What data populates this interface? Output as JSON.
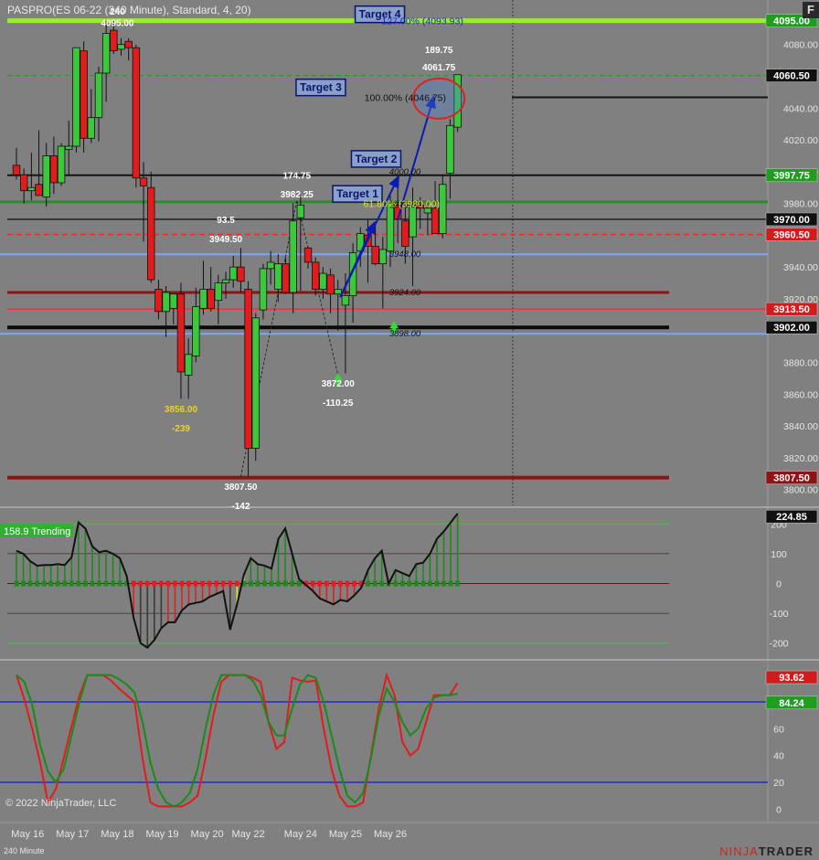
{
  "header": {
    "title": "PASPRO(ES 06-22 (240 Minute), Standard, 4, 20)",
    "f_button": "F",
    "copyright": "© 2022 NinjaTrader, LLC",
    "timeframe": "240 Minute",
    "brand_a": "NINJA",
    "brand_b": "TRADER"
  },
  "colors": {
    "bg": "#808080",
    "up": "#3cc83c",
    "down": "#e01c1c",
    "lime": "#96f032",
    "navy": "#0a146e"
  },
  "chart_data": [
    {
      "type": "candlestick",
      "ylim": [
        3790,
        4108
      ],
      "yticks": [
        3800,
        3820,
        3840,
        3860,
        3880,
        3900,
        3920,
        3940,
        3960,
        3980,
        4000,
        4020,
        4040,
        4060,
        4080
      ],
      "ytick_labels": [
        "3800.00",
        "3820.00",
        "3840.00",
        "3860.00",
        "3880.00",
        "3900.00",
        "3920.00",
        "3940.00",
        "3960.00",
        "3980.00",
        "4000.00",
        "4020.00",
        "4040.00",
        "4060.00",
        "4080.00"
      ],
      "x_labels": [
        {
          "text": "May 16",
          "i": 1.5
        },
        {
          "text": "May 17",
          "i": 7.5
        },
        {
          "text": "May 18",
          "i": 13.5
        },
        {
          "text": "May 19",
          "i": 19.5
        },
        {
          "text": "May 20",
          "i": 25.5
        },
        {
          "text": "May 22",
          "i": 31.0
        },
        {
          "text": "May 24",
          "i": 38.0
        },
        {
          "text": "May 25",
          "i": 44.0
        },
        {
          "text": "May 26",
          "i": 50.0
        }
      ],
      "candles": [
        [
          4004,
          4015,
          3995,
          3998
        ],
        [
          3998,
          4002,
          3980,
          3988
        ],
        [
          3988,
          4012,
          3982,
          3990
        ],
        [
          3992,
          4026,
          3986,
          3985
        ],
        [
          3984,
          4018,
          3978,
          4010
        ],
        [
          4010,
          4022,
          3986,
          3993
        ],
        [
          3993,
          4018,
          3991,
          4016
        ],
        [
          4014,
          4032,
          3998,
          4016
        ],
        [
          4016,
          4078,
          4012,
          4078
        ],
        [
          4076,
          4082,
          4012,
          4021
        ],
        [
          4021,
          4052,
          4018,
          4034
        ],
        [
          4034,
          4066,
          4019,
          4062
        ],
        [
          4062,
          4095,
          4044,
          4087
        ],
        [
          4089,
          4095,
          4074,
          4076
        ],
        [
          4077,
          4084,
          4073,
          4080
        ],
        [
          4082,
          4084,
          4070,
          4078
        ],
        [
          4078,
          4080,
          3990,
          3996
        ],
        [
          3996,
          4006,
          3956,
          3991
        ],
        [
          3990,
          4000,
          3930,
          3932
        ],
        [
          3926,
          3932,
          3907,
          3912
        ],
        [
          3912,
          3928,
          3896,
          3924
        ],
        [
          3914,
          3920,
          3904,
          3923
        ],
        [
          3923,
          3930,
          3857,
          3874
        ],
        [
          3872,
          3895,
          3857,
          3885
        ],
        [
          3884,
          3927,
          3880,
          3915
        ],
        [
          3914,
          3944,
          3910,
          3926
        ],
        [
          3926,
          3940,
          3912,
          3914
        ],
        [
          3919,
          3935,
          3904,
          3930
        ],
        [
          3930,
          3937,
          3920,
          3932
        ],
        [
          3932,
          3947,
          3927,
          3940
        ],
        [
          3940,
          3952,
          3924,
          3931
        ],
        [
          3926,
          3931,
          3808,
          3826
        ],
        [
          3826,
          3911,
          3818,
          3908
        ],
        [
          3913,
          3942,
          3907,
          3939
        ],
        [
          3939,
          3950,
          3929,
          3943
        ],
        [
          3926,
          3948,
          3918,
          3942
        ],
        [
          3942,
          3946,
          3923,
          3924
        ],
        [
          3924,
          3980,
          3911,
          3969
        ],
        [
          3971,
          3985,
          3925,
          3979
        ],
        [
          3952,
          3953,
          3939,
          3943
        ],
        [
          3943,
          3946,
          3922,
          3926
        ],
        [
          3926,
          3940,
          3920,
          3936
        ],
        [
          3935,
          3939,
          3911,
          3923
        ],
        [
          3923,
          3932,
          3900,
          3926
        ],
        [
          3916,
          3936,
          3873,
          3922
        ],
        [
          3922,
          3955,
          3905,
          3949
        ],
        [
          3950,
          3965,
          3940,
          3961
        ],
        [
          3960,
          3970,
          3930,
          3953
        ],
        [
          3953,
          3966,
          3941,
          3942
        ],
        [
          3942,
          3959,
          3914,
          3951
        ],
        [
          3950,
          3985,
          3940,
          3980
        ],
        [
          3979,
          3994,
          3955,
          3970
        ],
        [
          3969,
          3982,
          3942,
          3953
        ],
        [
          3959,
          3990,
          3928,
          3979
        ],
        [
          3979,
          3984,
          3964,
          3977
        ],
        [
          3974,
          3980,
          3960,
          3977
        ],
        [
          3977,
          3994,
          3963,
          3961
        ],
        [
          3961,
          3998,
          3958,
          3992
        ],
        [
          3999,
          4033,
          3983,
          4029
        ],
        [
          4028,
          4061,
          4025,
          4061
        ]
      ],
      "hlines": [
        {
          "y": 4095.0,
          "color": "#96f032",
          "w": 5
        },
        {
          "y": 4060.5,
          "color": "#1f9e1f",
          "w": 1.2,
          "dash": "5,4"
        },
        {
          "y": 4046.75,
          "color": "#141414",
          "w": 2
        },
        {
          "y": 3997.75,
          "color": "#141414",
          "w": 2
        },
        {
          "y": 3981.0,
          "color": "#2f8a2f",
          "w": 3
        },
        {
          "y": 3970.0,
          "color": "#141414",
          "w": 1.4
        },
        {
          "y": 3960.5,
          "color": "#ee2a2a",
          "w": 1.4,
          "dash": "6,4"
        },
        {
          "y": 3948.0,
          "color": "#7aa6ff",
          "w": 2
        },
        {
          "y": 3924.0,
          "color": "#8c1414",
          "w": 3
        },
        {
          "y": 3913.5,
          "color": "#ff2a2a",
          "w": 1.4
        },
        {
          "y": 3902.0,
          "color": "#0a0a0a",
          "w": 4
        },
        {
          "y": 3898.0,
          "color": "#7aa6ff",
          "w": 2
        },
        {
          "y": 3807.5,
          "color": "#8c1414",
          "w": 4
        }
      ],
      "right_tags": [
        {
          "y": 4095.0,
          "text": "4095.00",
          "bg": "#1e9e1e",
          "fg": "#ffffff"
        },
        {
          "y": 4060.5,
          "text": "4060.50",
          "bg": "#111111",
          "fg": "#ffffff"
        },
        {
          "y": 3997.75,
          "text": "3997.75",
          "bg": "#1e9e1e",
          "fg": "#ffffff"
        },
        {
          "y": 3970.0,
          "text": "3970.00",
          "bg": "#111111",
          "fg": "#ffffff"
        },
        {
          "y": 3960.5,
          "text": "3960.50",
          "bg": "#d21c1c",
          "fg": "#ffffff"
        },
        {
          "y": 3913.5,
          "text": "3913.50",
          "bg": "#d21c1c",
          "fg": "#ffffff"
        },
        {
          "y": 3902.0,
          "text": "3902.00",
          "bg": "#111111",
          "fg": "#ffffff"
        },
        {
          "y": 3807.5,
          "text": "3807.50",
          "bg": "#8c1414",
          "fg": "#ffffff"
        }
      ],
      "level_labels": [
        {
          "y": 4000.0,
          "text": "4000.00",
          "i": 50.0,
          "color": "#111",
          "italic": true
        },
        {
          "y": 3979.0,
          "text": "3979.00",
          "i": 50.0,
          "color": "#111",
          "italic": true
        },
        {
          "y": 3948.0,
          "text": "3948.00",
          "i": 50.0,
          "color": "#111",
          "italic": true
        },
        {
          "y": 3924.0,
          "text": "3924.00",
          "i": 50.0,
          "color": "#111",
          "italic": true
        },
        {
          "y": 3898.0,
          "text": "3898.00",
          "i": 50.0,
          "color": "#111",
          "italic": true
        }
      ],
      "fib_labels": [
        {
          "y": 4095.0,
          "text": "127.00% (4093.93)",
          "i": 54.3,
          "color": "#2020d8"
        },
        {
          "y": 4046.75,
          "text": "100.00% (4046.75)",
          "i": 52.0,
          "color": "#111"
        },
        {
          "y": 3980.0,
          "text": "61.80% (3980.00)",
          "i": 51.5,
          "color": "#f0e020"
        }
      ],
      "swing_labels": [
        {
          "text": "240",
          "i": 13.5,
          "y": 4101,
          "color": "#ffffff"
        },
        {
          "text": "4095.00",
          "i": 13.5,
          "y": 4094,
          "color": "#ffffff"
        },
        {
          "text": "189.75",
          "i": 56.5,
          "y": 4077,
          "color": "#ffffff"
        },
        {
          "text": "4061.75",
          "i": 56.5,
          "y": 4066,
          "color": "#ffffff"
        },
        {
          "text": "174.75",
          "i": 37.5,
          "y": 3998,
          "color": "#ffffff"
        },
        {
          "text": "3982.25",
          "i": 37.5,
          "y": 3986,
          "color": "#ffffff"
        },
        {
          "text": "93.5",
          "i": 28.0,
          "y": 3970,
          "color": "#ffffff"
        },
        {
          "text": "3949.50",
          "i": 28.0,
          "y": 3958,
          "color": "#ffffff"
        },
        {
          "text": "3856.00",
          "i": 22.0,
          "y": 3851,
          "color": "#f0d020"
        },
        {
          "text": "-239",
          "i": 22.0,
          "y": 3839,
          "color": "#f0d020"
        },
        {
          "text": "3872.00",
          "i": 43.0,
          "y": 3867,
          "color": "#ffffff"
        },
        {
          "text": "-110.25",
          "i": 43.0,
          "y": 3855,
          "color": "#ffffff"
        },
        {
          "text": "3807.50",
          "i": 30.0,
          "y": 3802,
          "color": "#ffffff"
        },
        {
          "text": "-142",
          "i": 30.0,
          "y": 3790,
          "color": "#ffffff"
        }
      ],
      "targets": [
        {
          "text": "Target 4",
          "i": 48.6,
          "y": 4099
        },
        {
          "text": "Target 3",
          "i": 40.7,
          "y": 4053
        },
        {
          "text": "Target 2",
          "i": 48.1,
          "y": 4008
        },
        {
          "text": "Target 1",
          "i": 45.6,
          "y": 3986
        }
      ],
      "arrows": [
        {
          "i1": 43.3,
          "y1": 3921,
          "i2": 51.1,
          "y2": 3997
        },
        {
          "i1": 43.3,
          "y1": 3921,
          "i2": 47.9,
          "y2": 3968
        },
        {
          "i1": 51.0,
          "y1": 3970,
          "i2": 55.8,
          "y2": 4047
        }
      ],
      "zigzag": [
        [
          30.0,
          3808
        ],
        [
          37.5,
          3982
        ],
        [
          43.0,
          3872
        ]
      ],
      "circle": {
        "i": 56.5,
        "y": 4046,
        "rx": 28,
        "ry": 22
      }
    },
    {
      "type": "line",
      "title": "158.9 Trending",
      "ylim": [
        -250,
        250
      ],
      "yticks": [
        -200,
        -100,
        0,
        100,
        200
      ],
      "ytick_labels": [
        "-200",
        "-100",
        "0",
        "100",
        "200"
      ],
      "current": {
        "text": "224.85",
        "y": 224.85
      },
      "bands": [
        {
          "y": 200,
          "color": "#40c040"
        },
        {
          "y": 100,
          "color": "#40e0f0"
        },
        {
          "y": -100,
          "color": "#40e0f0"
        },
        {
          "y": -200,
          "color": "#40c040"
        }
      ],
      "values": [
        110,
        100,
        75,
        60,
        62,
        62,
        65,
        62,
        88,
        205,
        185,
        125,
        105,
        110,
        100,
        85,
        25,
        -115,
        -200,
        -215,
        -190,
        -150,
        -130,
        -130,
        -90,
        -70,
        -65,
        -60,
        -45,
        -35,
        -25,
        -155,
        -70,
        30,
        85,
        65,
        60,
        50,
        150,
        185,
        100,
        15,
        -5,
        -25,
        -50,
        -60,
        -70,
        -55,
        -60,
        -40,
        -15,
        45,
        85,
        110,
        0,
        45,
        35,
        25,
        65,
        70,
        100,
        150,
        175,
        205,
        235
      ]
    },
    {
      "type": "line",
      "ylim": [
        -10,
        110
      ],
      "yticks": [
        0,
        20,
        40,
        60,
        80
      ],
      "ytick_labels": [
        "0",
        "20",
        "40",
        "60",
        "80"
      ],
      "hlines": [
        {
          "y": 80,
          "color": "#1c2ad8"
        },
        {
          "y": 20,
          "color": "#1c2ad8"
        }
      ],
      "series": [
        {
          "color": "#e01c1c",
          "current": {
            "text": "93.62",
            "y": 93.62
          },
          "values": [
            100,
            82,
            60,
            35,
            5,
            15,
            38,
            62,
            85,
            100,
            100,
            100,
            96,
            90,
            85,
            80,
            38,
            5,
            2,
            2,
            2,
            2,
            5,
            10,
            38,
            70,
            95,
            100,
            100,
            100,
            98,
            95,
            65,
            45,
            50,
            98,
            96,
            95,
            96,
            60,
            30,
            10,
            2,
            2,
            5,
            40,
            75,
            100,
            85,
            50,
            40,
            45,
            65,
            85,
            85,
            85,
            94
          ]
        },
        {
          "color": "#1a8a1a",
          "current": {
            "text": "84.24",
            "y": 84.24
          },
          "values": [
            100,
            95,
            78,
            48,
            28,
            20,
            30,
            55,
            80,
            100,
            100,
            100,
            100,
            97,
            93,
            87,
            65,
            35,
            15,
            5,
            2,
            5,
            12,
            30,
            60,
            85,
            100,
            100,
            100,
            100,
            96,
            85,
            65,
            55,
            55,
            75,
            93,
            100,
            98,
            80,
            55,
            30,
            10,
            5,
            12,
            38,
            70,
            90,
            80,
            65,
            55,
            60,
            75,
            83,
            85,
            85,
            86
          ]
        }
      ]
    }
  ]
}
